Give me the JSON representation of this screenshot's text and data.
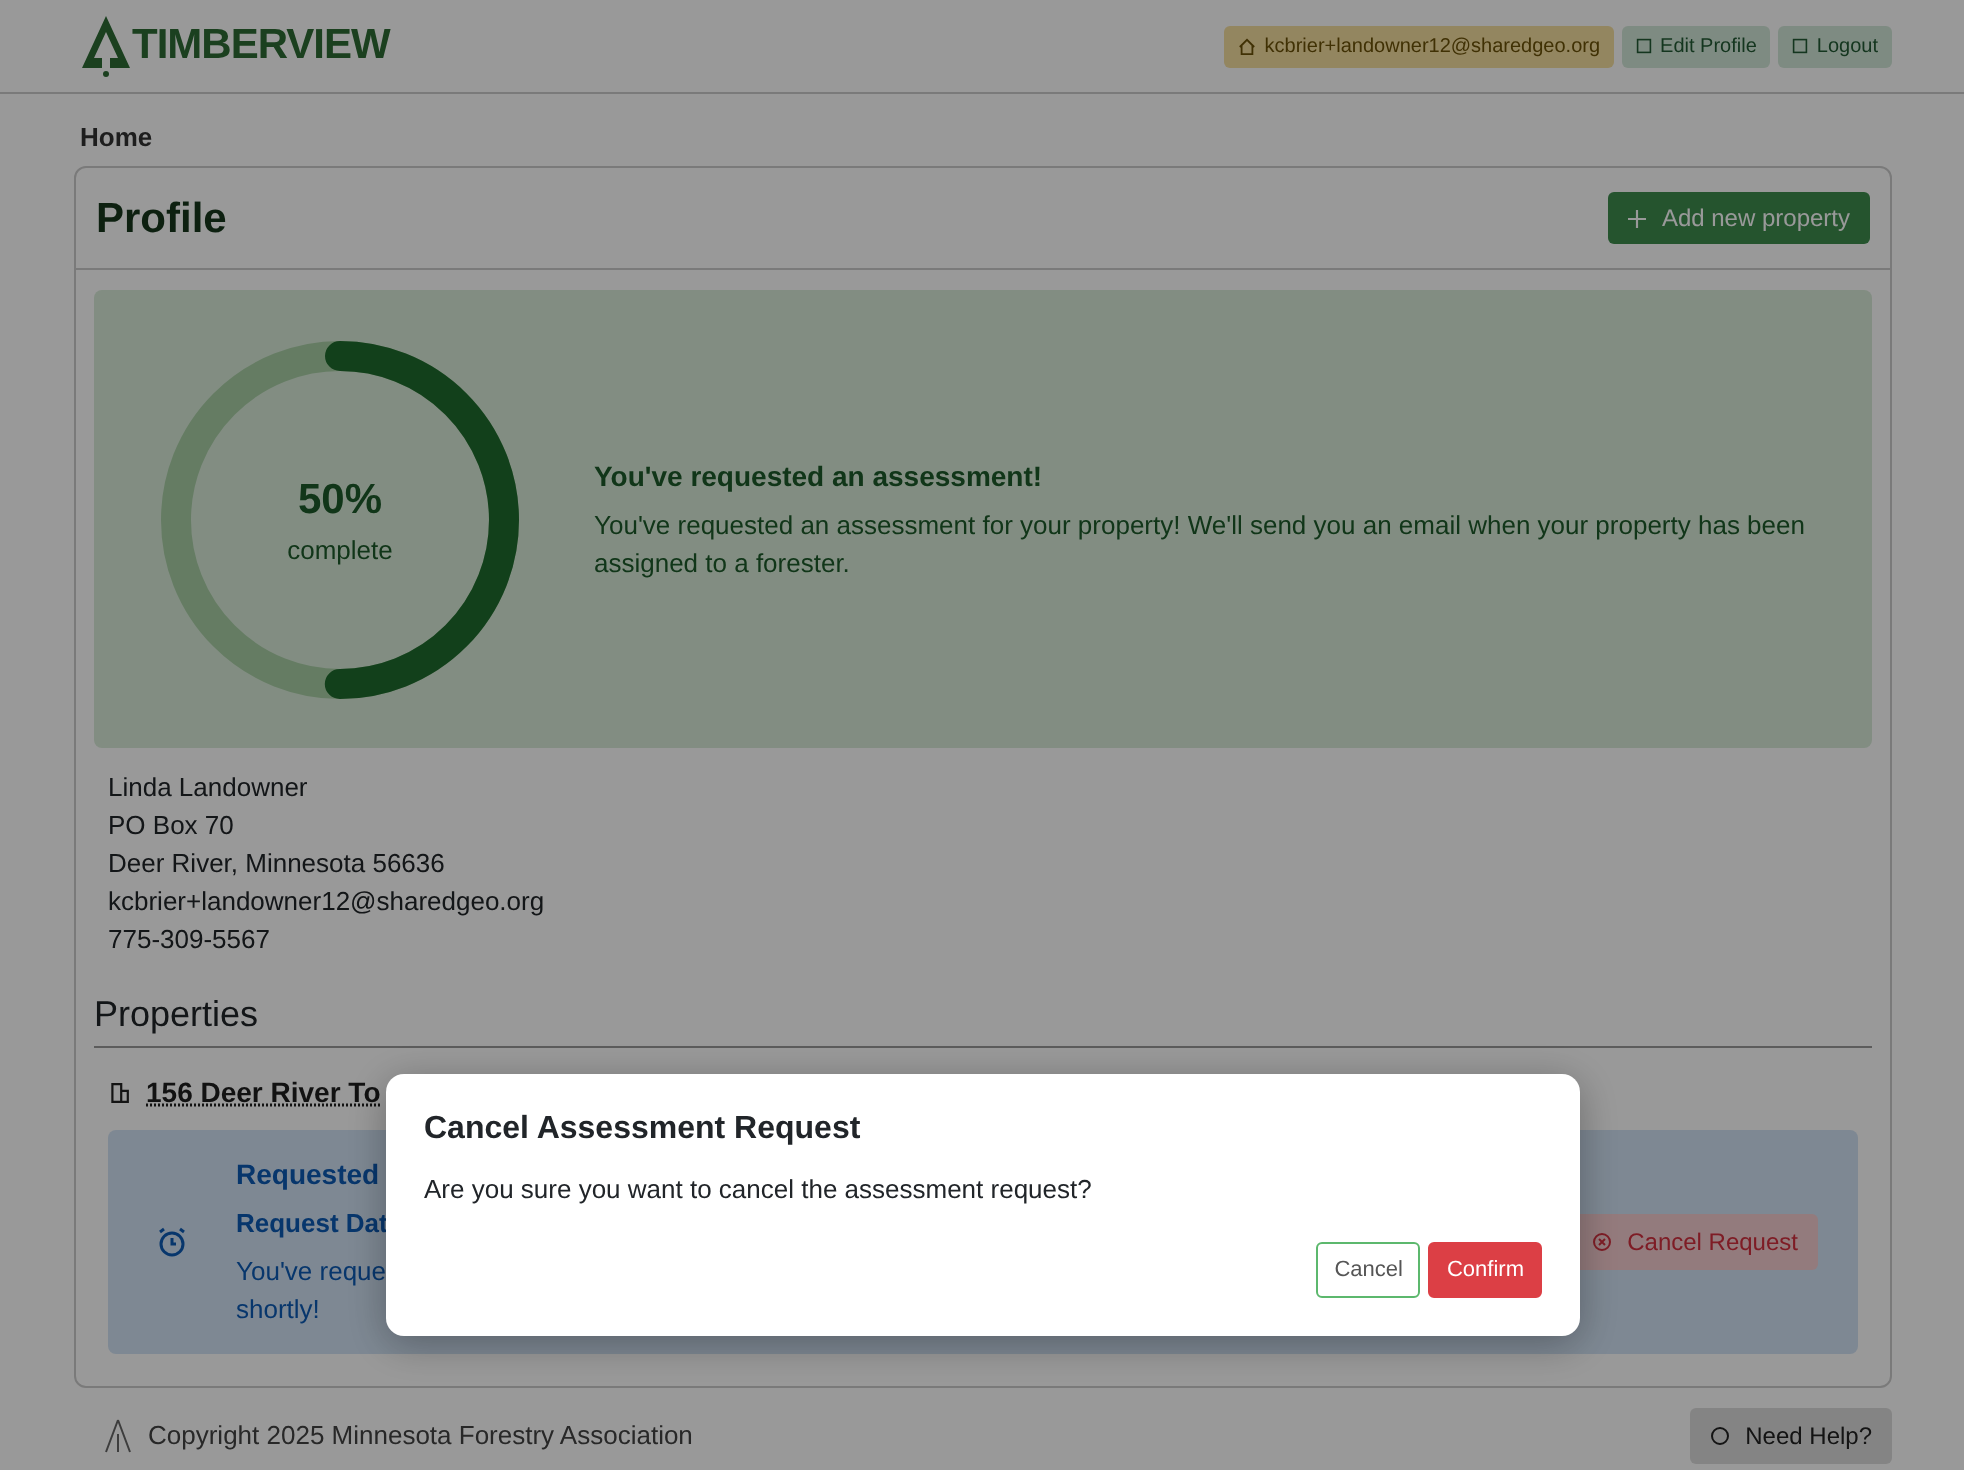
{
  "brand": "TIMBERVIEW",
  "nav": {
    "user": "kcbrier+landowner12@sharedgeo.org",
    "buttons": [
      "Edit Profile",
      "Logout"
    ]
  },
  "breadcrumb": "Home",
  "profile": {
    "title": "Profile",
    "add_button": "Add new property",
    "progress": {
      "level": 0.5,
      "percent": "50%",
      "caption": "complete",
      "heading": "You've requested an assessment!",
      "message": "You've requested an assessment for your property! We'll send you an email when your property has been assigned to a forester."
    },
    "contact": [
      "Linda Landowner",
      "PO Box 70",
      "Deer River, Minnesota 56636",
      "kcbrier+landowner12@sharedgeo.org",
      "775-309-5567"
    ]
  },
  "properties": {
    "title": "Properties",
    "items": [
      {
        "name": "156 Deer River To",
        "status": "Requested",
        "date_label": "Request Dat",
        "message": "You've reque",
        "message_end": "shortly!",
        "cancel_button": "Cancel Request"
      }
    ]
  },
  "footer": {
    "copyright": "Copyright 2025 Minnesota Forestry Association",
    "help": "Need Help?"
  },
  "modal": {
    "title": "Cancel Assessment Request",
    "body": "Are you sure you want to cancel the assessment request?",
    "buttons": [
      {
        "label": "Cancel",
        "kind": "secondary"
      },
      {
        "label": "Confirm",
        "kind": "danger"
      }
    ]
  }
}
